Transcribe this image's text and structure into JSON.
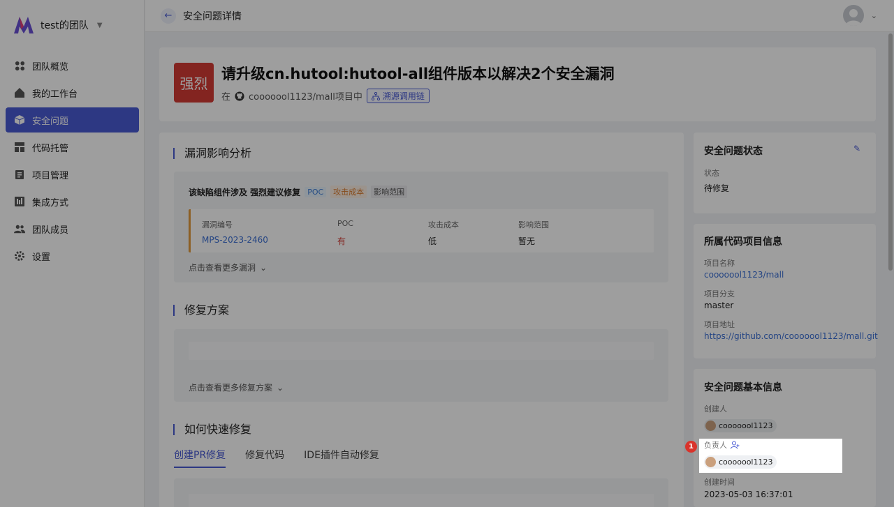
{
  "sidebar": {
    "team_name": "test的团队",
    "items": [
      {
        "label": "团队概览",
        "icon": "overview-icon"
      },
      {
        "label": "我的工作台",
        "icon": "home-icon"
      },
      {
        "label": "安全问题",
        "icon": "cube-icon"
      },
      {
        "label": "代码托管",
        "icon": "layout-icon"
      },
      {
        "label": "项目管理",
        "icon": "clipboard-icon"
      },
      {
        "label": "集成方式",
        "icon": "integration-icon"
      },
      {
        "label": "团队成员",
        "icon": "users-icon"
      },
      {
        "label": "设置",
        "icon": "gear-icon"
      }
    ],
    "active_index": 2
  },
  "topbar": {
    "breadcrumb": "安全问题详情"
  },
  "issue": {
    "level_badge": "强烈",
    "title": "请升级cn.hutool:hutool-all组件版本以解决2个安全漏洞",
    "sub_prefix": "在",
    "project": "cooooool1123/mall项目中",
    "trace_button": "溯源调用链"
  },
  "impact": {
    "section_title": "漏洞影响分析",
    "summary": "该缺陷组件涉及 强烈建议修复",
    "tags": [
      "POC",
      "攻击成本",
      "影响范围"
    ],
    "columns": [
      "漏洞编号",
      "POC",
      "攻击成本",
      "影响范围"
    ],
    "row": {
      "id": "MPS-2023-2460",
      "poc": "有",
      "cost": "低",
      "scope": "暂无"
    },
    "more": "点击查看更多漏洞"
  },
  "fix": {
    "section_title": "修复方案",
    "more": "点击查看更多修复方案"
  },
  "quickfix": {
    "section_title": "如何快速修复",
    "tabs": [
      "创建PR修复",
      "修复代码",
      "IDE插件自动修复"
    ]
  },
  "status_card": {
    "title": "安全问题状态",
    "label": "状态",
    "value": "待修复"
  },
  "project_card": {
    "title": "所属代码项目信息",
    "name_label": "项目名称",
    "name_value": "cooooool1123/mall",
    "branch_label": "项目分支",
    "branch_value": "master",
    "url_label": "项目地址",
    "url_value": "https://github.com/cooooool1123/mall.git"
  },
  "basic_card": {
    "title": "安全问题基本信息",
    "creator_label": "创建人",
    "creator": "cooooool1123",
    "owner_label": "负责人",
    "owner": "cooooool1123",
    "created_label": "创建时间",
    "created_value": "2023-05-03 16:37:01"
  },
  "highlight_marker": "1",
  "colors": {
    "accent": "#4a5bd4",
    "danger": "#d33b35",
    "warning": "#e39a3b",
    "link": "#3b6fd4"
  }
}
